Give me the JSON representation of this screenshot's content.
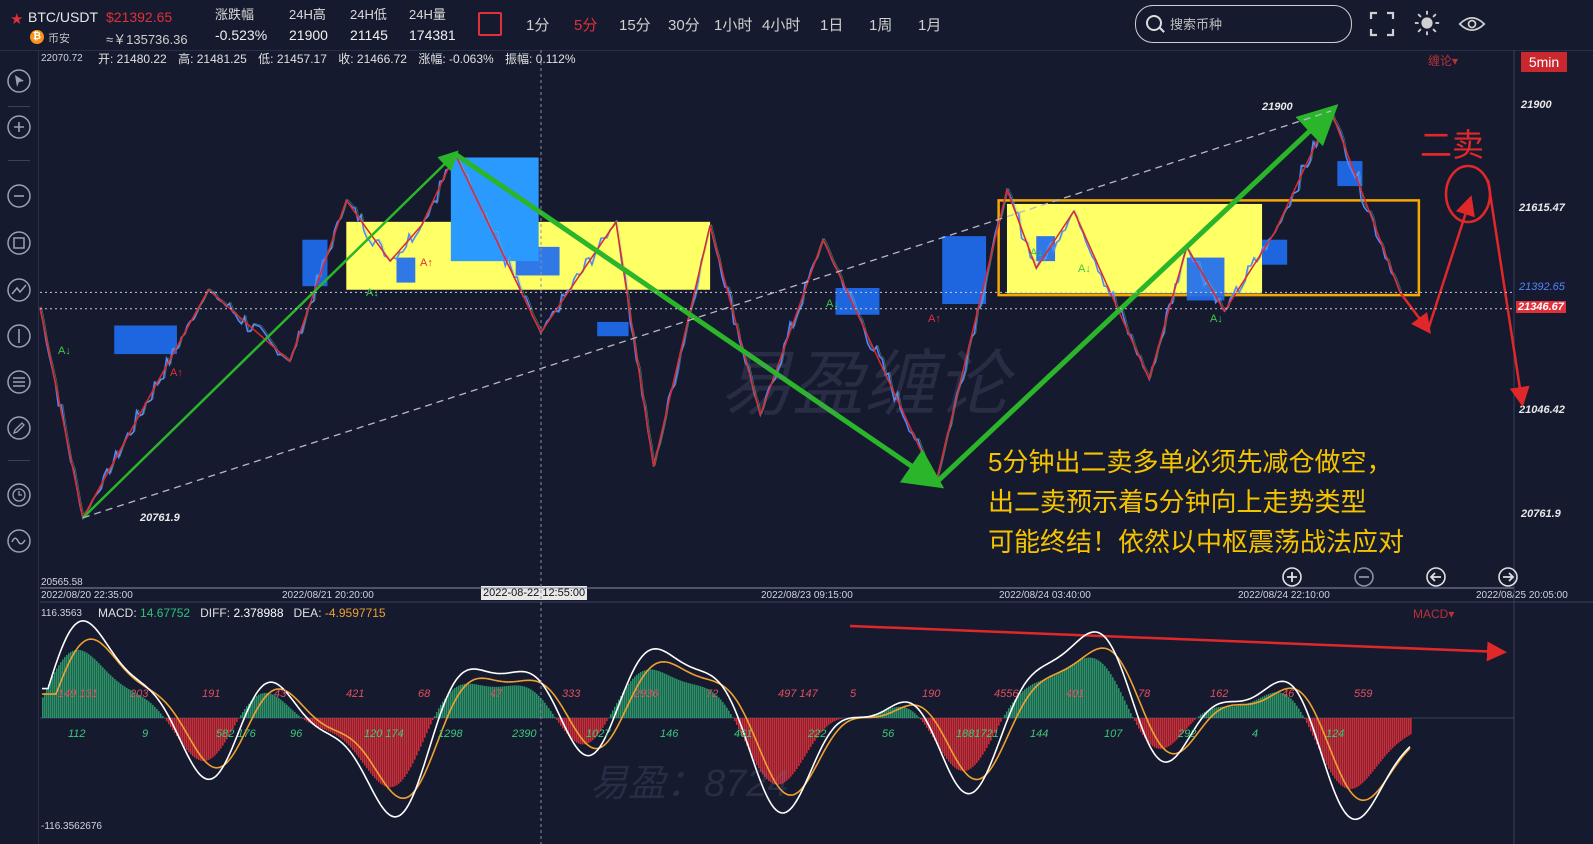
{
  "pair": {
    "name": "BTC/USDT",
    "price": "$21392.65",
    "exchange": "币安",
    "cny": "≈￥135736.36",
    "coin_icon": "bitcoin-icon",
    "star_icon": "star-icon"
  },
  "stats": [
    {
      "label": "涨跌幅",
      "value": "-0.523%"
    },
    {
      "label": "24H高",
      "value": "21900"
    },
    {
      "label": "24H低",
      "value": "21145"
    },
    {
      "label": "24H量",
      "value": "174381"
    }
  ],
  "periods": [
    {
      "label": "1分",
      "active": false
    },
    {
      "label": "5分",
      "active": true
    },
    {
      "label": "15分",
      "active": false
    },
    {
      "label": "30分",
      "active": false
    },
    {
      "label": "1小时",
      "active": false
    },
    {
      "label": "4小时",
      "active": false
    },
    {
      "label": "1日",
      "active": false
    },
    {
      "label": "1周",
      "active": false
    },
    {
      "label": "1月",
      "active": false
    }
  ],
  "search": {
    "placeholder": "搜索币种"
  },
  "toolbar_icons": [
    "fullscreen-icon",
    "theme-icon",
    "eye-icon"
  ],
  "sidebar_icons": [
    "cursor-icon",
    "zoom-in-icon",
    "zoom-out-icon",
    "rectangle-icon",
    "trend-line-icon",
    "vertical-line-icon",
    "fibonacci-icon",
    "pencil-icon",
    "clock-icon",
    "wave-icon"
  ],
  "ohlc": {
    "open": "开: 21480.22",
    "high": "高: 21481.25",
    "low": "低: 21457.17",
    "close": "收: 21466.72",
    "change": "涨幅: -0.063%",
    "amplitude": "振幅: 0.112%"
  },
  "timeframe_badge": "5min",
  "indicator_dropdown": "缠论",
  "macd_dropdown": "MACD",
  "main_axis": {
    "top": "22070.72",
    "bottom": "20565.58"
  },
  "price_labels": {
    "high": "21900",
    "low": "20761.9"
  },
  "right_axis": [
    "21900",
    "21615.47",
    "21392.65",
    "21346.67",
    "21046.42",
    "20761.9"
  ],
  "dates": [
    "2022/08/20 22:35:00",
    "2022/08/21 20:20:00",
    "2022/08/23 09:15:00",
    "2022/08/24 03:40:00",
    "2022/08/24 22:10:00",
    "2022/08/25 20:05:00"
  ],
  "cursor_date": "2022-08-22 12:55:00",
  "macd": {
    "macd_label": "MACD:",
    "macd_value": "14.67752",
    "diff_label": "DIFF:",
    "diff_value": "2.378988",
    "dea_label": "DEA:",
    "dea_value": "-4.9597715",
    "axis_top": "116.3563",
    "axis_bottom": "-116.3562676",
    "top_numbers": [
      "149 131",
      "203",
      "191",
      "43",
      "421",
      "68",
      "47",
      "333",
      "2936",
      "72",
      "497 147",
      "5",
      "190",
      "4556",
      "401",
      "78",
      "162",
      "46",
      "559"
    ],
    "bottom_numbers": [
      "112",
      "9",
      "582 176",
      "96",
      "120 174",
      "1298",
      "2390",
      "1027",
      "146",
      "461",
      "222",
      "56",
      "1881721",
      "144",
      "107",
      "292",
      "4",
      "124"
    ]
  },
  "annotation": {
    "lines": [
      "5分钟出二卖多单必须先减仓做空，",
      "出二卖预示着5分钟向上走势类型",
      "可能终结！依然以中枢震荡战法应对"
    ],
    "signal": "二卖"
  },
  "markers": {
    "buy": "A↓",
    "sell": "A↑"
  },
  "watermarks": {
    "main": "易盈缠论",
    "macd": "易盈：8724"
  },
  "nav_icons": [
    "plus-circle-icon",
    "minus-circle-icon",
    "arrow-left-circle-icon",
    "arrow-right-circle-icon"
  ],
  "colors": {
    "background": "#161a2e",
    "price_line": "#4f86ff",
    "bi_line": "#e0282a",
    "segment": "#2ab52a",
    "zone_fill": "#ffff66",
    "box_stroke": "#f5a800",
    "bull_bar": "#2e9e6e",
    "bear_bar": "#e0303a",
    "diff_line": "#ffffff",
    "dea_line": "#f0a030",
    "annotation": "#f5c400"
  },
  "chart_data": {
    "type": "candlestick",
    "symbol": "BTC/USDT",
    "interval": "5min",
    "ylim": [
      20565.58,
      22070.72
    ],
    "bi_pivots": [
      {
        "t": "2022/08/20 22:35",
        "price": 21350
      },
      {
        "t": "2022/08/21 02:00",
        "price": 20761.9
      },
      {
        "t": "2022/08/21 12:00",
        "price": 21400
      },
      {
        "t": "2022/08/21 18:30",
        "price": 21200
      },
      {
        "t": "2022/08/21 23:00",
        "price": 21650
      },
      {
        "t": "2022/08/22 02:30",
        "price": 21480
      },
      {
        "t": "2022/08/22 05:00",
        "price": 21580
      },
      {
        "t": "2022/08/22 07:40",
        "price": 21780
      },
      {
        "t": "2022/08/22 14:30",
        "price": 21280
      },
      {
        "t": "2022/08/22 20:30",
        "price": 21590
      },
      {
        "t": "2022/08/22 23:30",
        "price": 20905
      },
      {
        "t": "2022/08/23 04:00",
        "price": 21580
      },
      {
        "t": "2022/08/23 08:00",
        "price": 21050
      },
      {
        "t": "2022/08/23 13:00",
        "price": 21540
      },
      {
        "t": "2022/08/23 22:00",
        "price": 20860
      },
      {
        "t": "2022/08/24 03:40",
        "price": 21680
      },
      {
        "t": "2022/08/24 06:00",
        "price": 21460
      },
      {
        "t": "2022/08/24 09:00",
        "price": 21620
      },
      {
        "t": "2022/08/24 15:00",
        "price": 21150
      },
      {
        "t": "2022/08/24 18:00",
        "price": 21520
      },
      {
        "t": "2022/08/24 21:00",
        "price": 21340
      },
      {
        "t": "2022/08/25 01:00",
        "price": 21560
      },
      {
        "t": "2022/08/25 05:30",
        "price": 21900
      },
      {
        "t": "2022/08/25 11:00",
        "price": 21392.65
      }
    ],
    "segment_pivots": [
      {
        "t": "2022/08/21 02:00",
        "price": 20761.9
      },
      {
        "t": "2022/08/22 07:40",
        "price": 21780
      },
      {
        "t": "2022/08/23 22:00",
        "price": 20860
      },
      {
        "t": "2022/08/25 05:30",
        "price": 21900
      }
    ],
    "zhongshu": [
      {
        "name": "zone-1",
        "high": 21590,
        "low": 21400
      },
      {
        "name": "zone-2",
        "high": 21640,
        "low": 21390
      }
    ],
    "last_price": 21392.65,
    "marker_price": 21346.67,
    "macd_range": [
      -116.3562676,
      116.3563
    ]
  }
}
